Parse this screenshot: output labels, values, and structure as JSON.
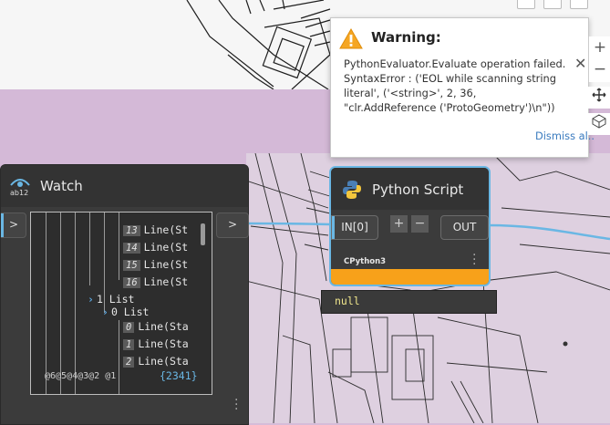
{
  "warning": {
    "title": "Warning:",
    "message": "PythonEvaluator.Evaluate operation failed. SyntaxError : ('EOL while scanning string literal', ('<string>', 2, 36, \"clr.AddReference ('ProtoGeometry')\\n\"))",
    "dismiss": "Dismiss al..",
    "close_icon": "close-icon"
  },
  "zoom": {
    "plus": "+",
    "minus": "−"
  },
  "watch": {
    "title": "Watch",
    "in_port": ">",
    "out_port": ">",
    "rows": [
      {
        "idx": "13",
        "text": "Line(St"
      },
      {
        "idx": "14",
        "text": "Line(St"
      },
      {
        "idx": "15",
        "text": "Line(St"
      },
      {
        "idx": "16",
        "text": "Line(St"
      },
      {
        "label": "1 List"
      },
      {
        "label": "0 List"
      },
      {
        "idx": "0",
        "text": "Line(Sta"
      },
      {
        "idx": "1",
        "text": "Line(Sta"
      },
      {
        "idx": "2",
        "text": "Line(Sta"
      }
    ],
    "levels": "@6@5@4@3@2 @1",
    "count": "{2341}"
  },
  "python": {
    "title": "Python Script",
    "in_port": "IN[0]",
    "out_port": "OUT",
    "add": "+",
    "remove": "−",
    "engine": "CPython3",
    "output_value": "null"
  },
  "colors": {
    "accent": "#6ab7e4",
    "warning_bar": "#f7a11a"
  }
}
